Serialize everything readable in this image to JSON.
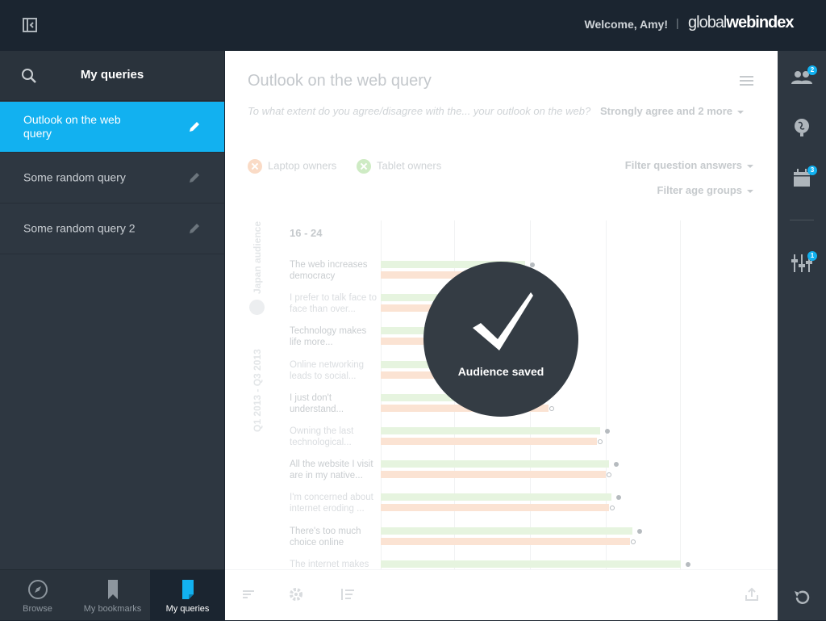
{
  "header": {
    "welcome": "Welcome, Amy!",
    "separator": "|",
    "brand_thin": "global",
    "brand_bold": "webindex",
    "collapse_icon": "panel-collapse-icon"
  },
  "sidebar": {
    "title": "My queries",
    "search_icon": "search-icon",
    "items": [
      {
        "label": "Outlook on the web query",
        "active": true
      },
      {
        "label": "Some random query",
        "active": false
      },
      {
        "label": "Some random query 2",
        "active": false
      }
    ]
  },
  "bottom_nav": {
    "items": [
      {
        "label": "Browse",
        "icon": "compass-icon"
      },
      {
        "label": "My bookmarks",
        "icon": "bookmark-icon"
      },
      {
        "label": "My queries",
        "icon": "document-icon",
        "active": true
      }
    ]
  },
  "main": {
    "title": "Outlook on the web query",
    "question": "To what extent do you agree/disagree with the... your outlook on the web?",
    "answers": "Strongly agree and 2 more",
    "audiences": [
      {
        "label": "Laptop owners",
        "color": "#f7b98e"
      },
      {
        "label": "Tablet owners",
        "color": "#9fd98a"
      }
    ],
    "filter_answers": "Filter question answers",
    "filter_age": "Filter age groups",
    "side_audience": "Japan audience",
    "side_period": "Q1 2013 - Q3 2013",
    "age_group": "16 - 24"
  },
  "chart_data": {
    "type": "bar",
    "categories": [
      "The web increases democracy",
      "I prefer to talk face to face than over...",
      "Technology makes life more...",
      "Online networking leads to social...",
      "I just don't understand...",
      "Owning the last technological...",
      "All the website I visit are in my native...",
      "I'm concerned about internet eroding ...",
      "There's too much choice online",
      "The internet makes"
    ],
    "series": [
      {
        "name": "Tablet owners",
        "color": "#e6f4df",
        "values": [
          48,
          51,
          56,
          47,
          49,
          73,
          76,
          77,
          84,
          100
        ]
      },
      {
        "name": "Laptop owners",
        "color": "#fbe3d3",
        "values": [
          52,
          55,
          57,
          50,
          56,
          72,
          75,
          76,
          83,
          null
        ]
      }
    ]
  },
  "overlay": {
    "message": "Audience saved"
  },
  "right_bar": {
    "items": [
      {
        "icon": "audience-icon",
        "badge": "2"
      },
      {
        "icon": "globe-icon",
        "badge": ""
      },
      {
        "icon": "calendar-icon",
        "badge": "3"
      },
      {
        "icon": "sliders-icon",
        "badge": "1"
      }
    ],
    "undo_icon": "undo-icon"
  }
}
